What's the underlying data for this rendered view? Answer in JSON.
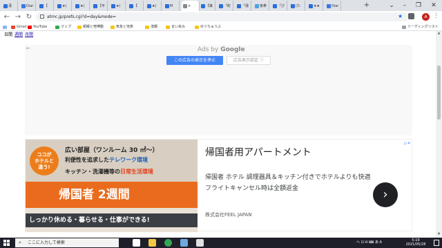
{
  "browser": {
    "tabs": [
      {
        "label": "漢",
        "color": "#2a6fdb"
      },
      {
        "label": "Diar",
        "color": "#3b78e7"
      },
      {
        "label": "【",
        "color": "#2a6fdb"
      },
      {
        "label": "★(",
        "color": "#2a6fdb"
      },
      {
        "label": "★(",
        "color": "#2a6fdb"
      },
      {
        "label": "【平",
        "color": "#2a6fdb"
      },
      {
        "label": "★(",
        "color": "#2a6fdb"
      },
      {
        "label": "【",
        "color": "#2a6fdb"
      },
      {
        "label": "★(",
        "color": "#2a6fdb"
      },
      {
        "label": "M",
        "color": "#2a6fdb"
      },
      {
        "label": "×",
        "color": "#888888"
      },
      {
        "label": "【東",
        "color": "#2a6fdb"
      },
      {
        "label": "「町",
        "color": "#2a6fdb"
      },
      {
        "label": "「運",
        "color": "#2a6fdb"
      },
      {
        "label": "後拳",
        "color": "#4aa3df"
      },
      {
        "label": "「び",
        "color": "#2a6fdb"
      },
      {
        "label": "(た",
        "color": "#2a6fdb"
      },
      {
        "label": "★★",
        "color": "#2a6fdb"
      },
      {
        "label": "Diar",
        "color": "#3b78e7"
      }
    ],
    "new_tab": "+",
    "url": "atmc.jp/prefs.cgi?d=day&mode=",
    "profile_initial": "A",
    "bookmarks": [
      {
        "label": "Gmail",
        "color": "#ea4335"
      },
      {
        "label": "YouTube",
        "color": "#ff0000"
      },
      {
        "label": "マップ",
        "color": "#34a853"
      },
      {
        "label": "頓曙と喧嘩動",
        "color": "#f5c518"
      },
      {
        "label": "気象と地表",
        "color": "#f5c518"
      },
      {
        "label": "漆鋼",
        "color": "#f5c518"
      },
      {
        "label": "まいあみ",
        "color": "#f5c518"
      },
      {
        "label": "ゆうちゅうぶ",
        "color": "#f5c518"
      }
    ],
    "reading_list": "リーディングリスト"
  },
  "page": {
    "nav": {
      "current": "日間",
      "links": [
        "週間",
        "月間"
      ]
    },
    "ad1": {
      "ads_by": "Ads by",
      "brand": "Google",
      "stop_button": "この広告の表示を停止",
      "settings_button": "広告表示設定 ⓘ"
    },
    "ad2": {
      "banner": {
        "bubble": "ココが\nホテルと\n違う!",
        "line1": "広い部屋（ワンルーム 30 ㎡〜）",
        "line2_prefix": "利便性を追求した",
        "line2_highlight": "テレワーク環境",
        "line3_prefix": "キッチン・洗濯機等の",
        "line3_highlight": "日常生活環境",
        "headline": "帰国者 2週間",
        "footer": "しっかり休める・暮らせる・仕事ができる!"
      },
      "title": "帰国者用アパートメント",
      "description": "帰国者 ホテル 調理器具＆キッチン付きでホテルよりも快適 フライトキャンセル時は全額返金",
      "company": "株式会社FEEL JAPAN",
      "arrow": "›"
    }
  },
  "taskbar": {
    "search_placeholder": "ここに入力して検索",
    "apps": [
      {
        "name": "task-view",
        "color": "#ffffff"
      },
      {
        "name": "file-explorer",
        "color": "#f2c744"
      },
      {
        "name": "chrome",
        "color": "#34a853"
      },
      {
        "name": "app-4",
        "color": "#6fa8dc"
      },
      {
        "name": "app-5",
        "color": "#e0e0e0"
      }
    ],
    "tray": "へ ⊡ ✉ ⌨ あ A",
    "time": "5:19",
    "date": "2021/05/28"
  },
  "colors": {
    "accent": "#4285f4",
    "orange": "#ea6b1d"
  }
}
